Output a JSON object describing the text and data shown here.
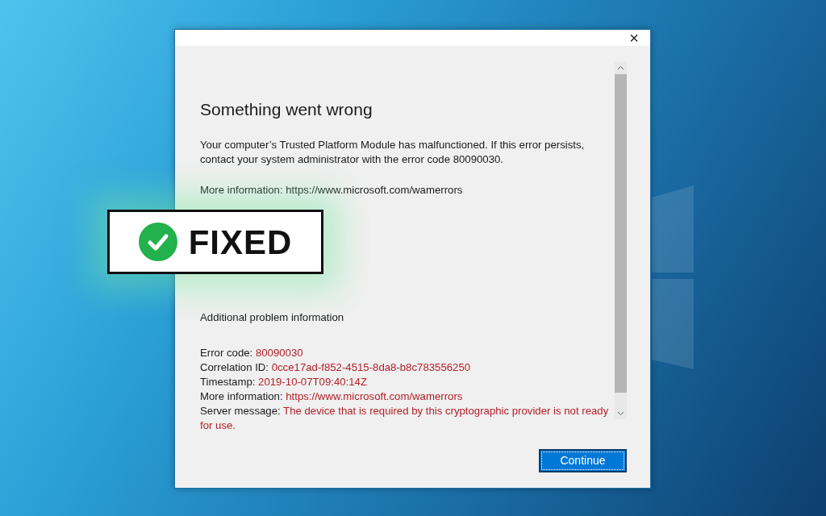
{
  "dialog": {
    "close": "×",
    "heading": "Something went wrong",
    "message": "Your computer’s Trusted Platform Module has malfunctioned. If this error persists, contact your system administrator with the error code 80090030.",
    "more_info": "More information: https://www.microsoft.com/wamerrors",
    "additional_heading": "Additional problem information",
    "details": [
      {
        "label": "Error code:",
        "value": "80090030"
      },
      {
        "label": "Correlation ID:",
        "value": "0cce17ad-f852-4515-8da8-b8c783556250"
      },
      {
        "label": "Timestamp:",
        "value": "2019-10-07T09:40:14Z"
      },
      {
        "label": "More information:",
        "value": "https://www.microsoft.com/wamerrors"
      },
      {
        "label": "Server message:",
        "value": "The device that is required by this cryptographic provider is not ready for use."
      }
    ],
    "button": "Continue"
  },
  "badge": {
    "label": "FIXED"
  }
}
